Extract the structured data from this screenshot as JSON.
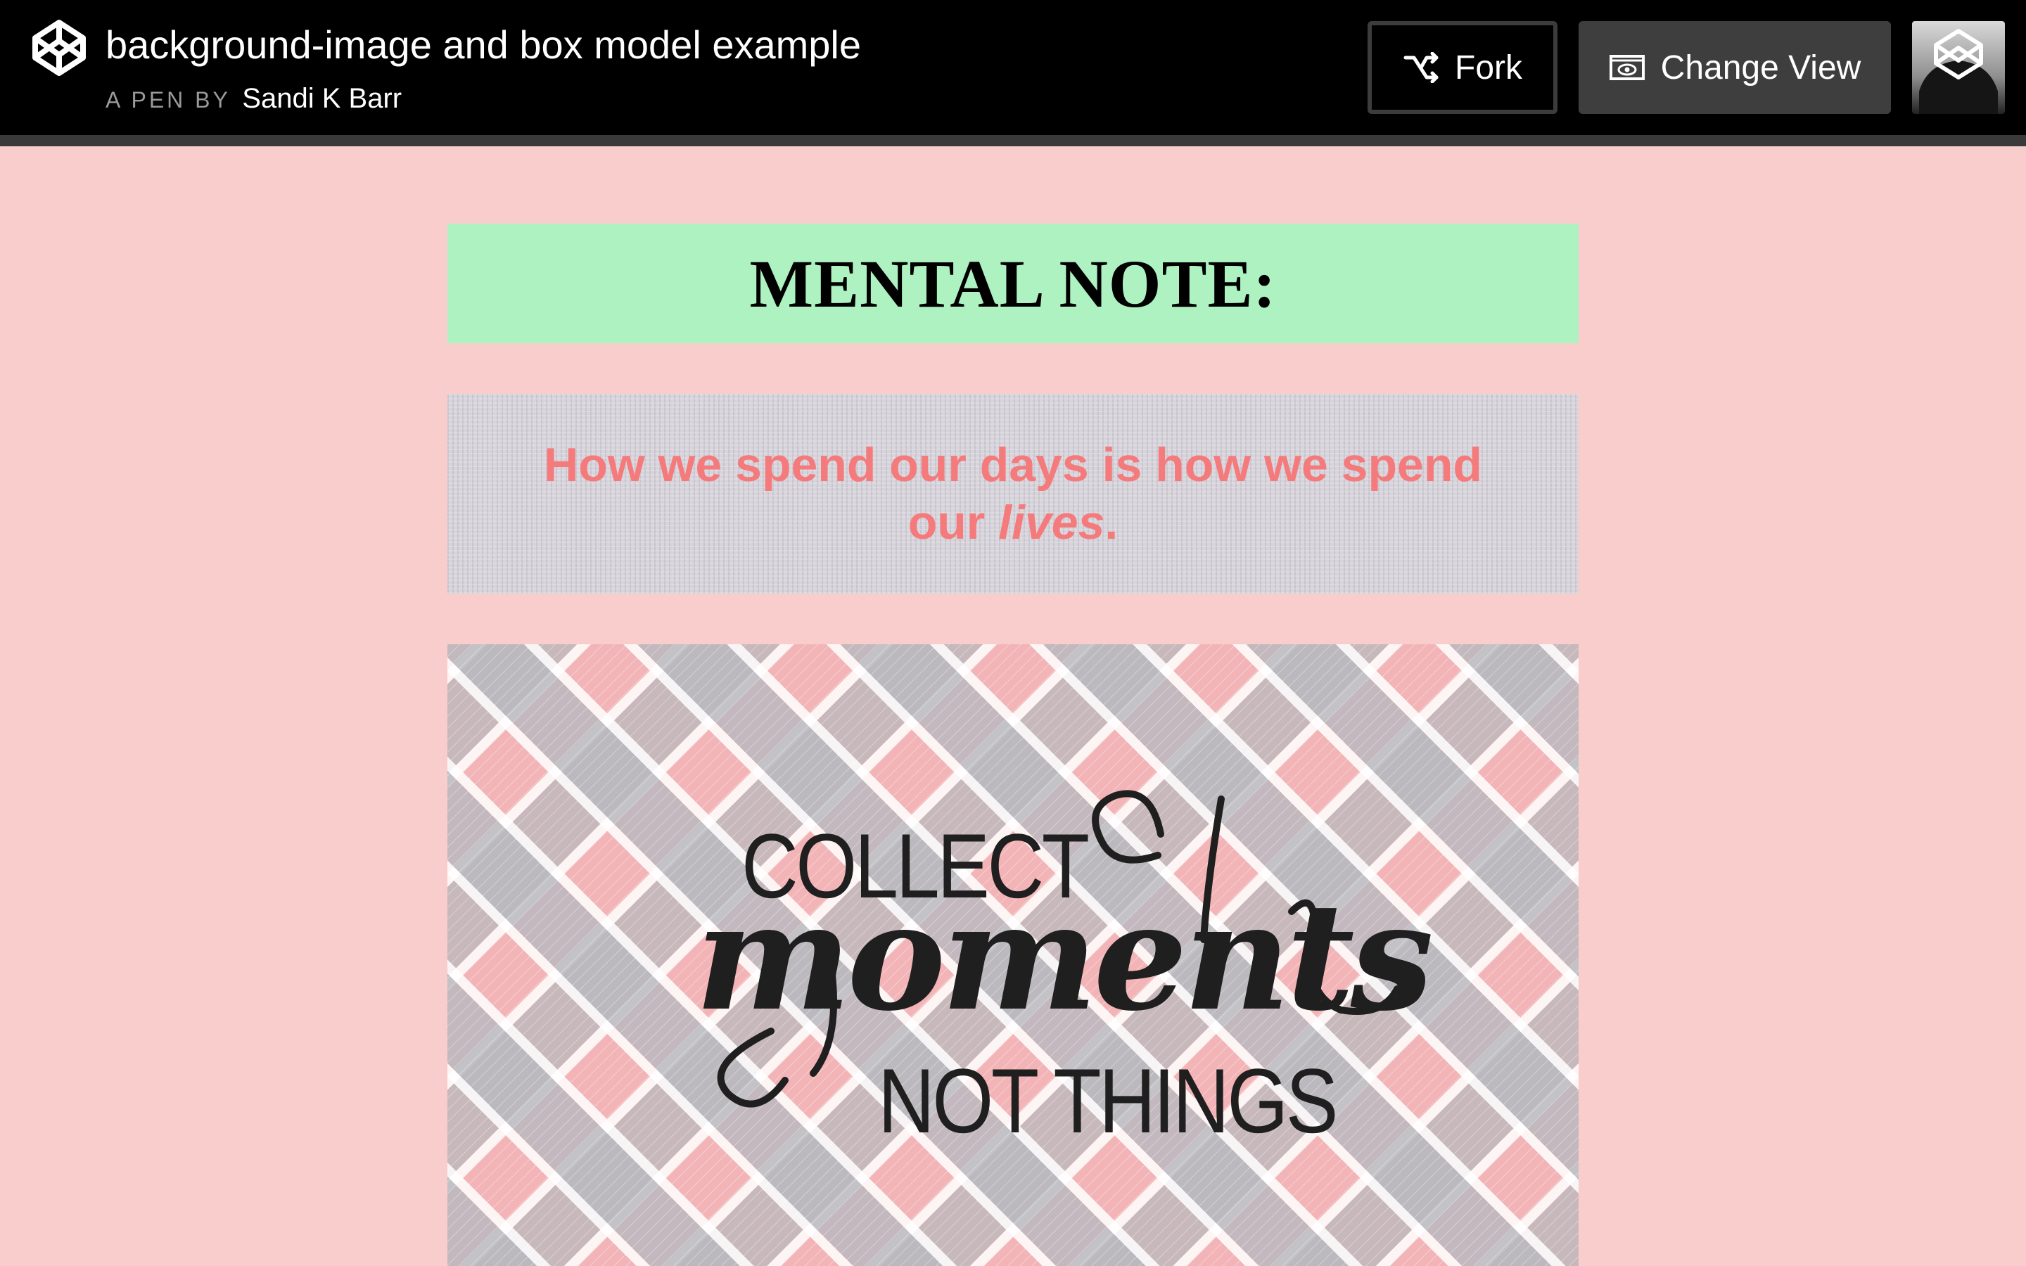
{
  "header": {
    "title": "background-image and box model example",
    "byline_prefix": "A PEN BY",
    "author": "Sandi K Barr",
    "fork_label": "Fork",
    "change_view_label": "Change View"
  },
  "content": {
    "note_title": "MENTAL NOTE:",
    "quote_main": "How we spend our days is how we spend our ",
    "quote_emphasis": "lives",
    "quote_end": ".",
    "art_line1": "COLLECT",
    "art_line2": "moments",
    "art_line3": "NOT THINGS"
  },
  "colors": {
    "page_background": "#f8cdcc",
    "note_background": "#aef2c2",
    "quote_text": "#f57a7c",
    "topbar": "#000000"
  },
  "icons": {
    "logo": "codepen-logo-icon",
    "fork": "fork-icon",
    "change_view": "eye-icon",
    "avatar": "user-avatar"
  }
}
